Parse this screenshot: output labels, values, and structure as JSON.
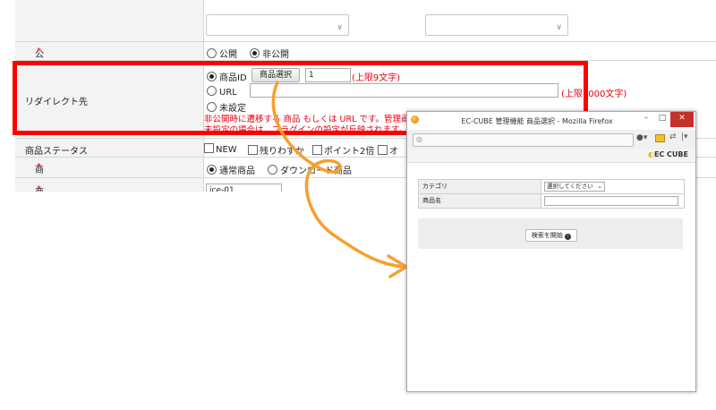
{
  "form": {
    "visibility": {
      "label": "公開・非公開",
      "required_mark": "*",
      "options": [
        "公開",
        "非公開"
      ],
      "selected": "非公開"
    },
    "redirect": {
      "label": "リダイレクト先",
      "option_product_id": "商品ID",
      "select_product_button": "商品選択",
      "product_id_value": "1",
      "product_id_limit": "(上限9文字)",
      "option_url": "URL",
      "url_value": "",
      "url_limit": "(上限1000文字)",
      "option_unset": "未設定",
      "note_line1": "非公開時に遷移する 商品 もしくは URL です。管理画面からの「確認」リンクでは遷移しません。",
      "note_line2": "未設定の場合は、プラグインの設定が反映されます。"
    },
    "product_status": {
      "label": "商品ステータス",
      "options": [
        "NEW",
        "残りわずか",
        "ポイント2倍",
        "オ"
      ]
    },
    "product_type": {
      "label": "商品種別",
      "required_mark": "*",
      "options": [
        "通常商品",
        "ダウンロード商品"
      ],
      "selected": "通常商品"
    },
    "product_code": {
      "label": "商品コード",
      "required_mark": "*",
      "value": "ice-01"
    }
  },
  "popup": {
    "title": "EC-CUBE 管理機能 商品選択 - Mozilla Firefox",
    "controls": [
      "–",
      "□",
      "✕"
    ],
    "logo": "EC CUBE",
    "category_label": "カテゴリ",
    "category_value": "選択してください",
    "product_name_label": "商品名",
    "product_name_value": "",
    "search_button": "検索を開始"
  },
  "colors": {
    "highlight": "#ff0000",
    "arrow": "#f7a02e",
    "note": "#e60012",
    "close": "#c7312c"
  }
}
